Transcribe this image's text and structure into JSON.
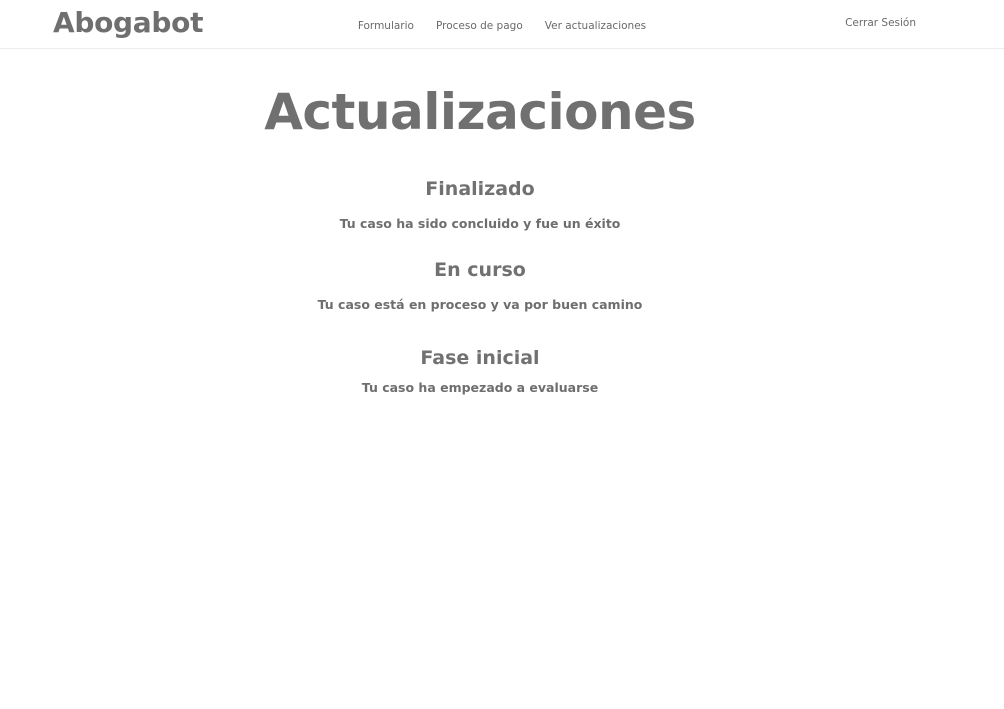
{
  "navbar": {
    "brand": "Abogabot",
    "links": [
      {
        "label": "Formulario"
      },
      {
        "label": "Proceso de pago"
      },
      {
        "label": "Ver actualizaciones"
      }
    ],
    "logout_label": "Cerrar Sesión"
  },
  "main": {
    "title": "Actualizaciones",
    "statuses": [
      {
        "title": "Finalizado",
        "description": "Tu caso ha sido concluido y fue un éxito"
      },
      {
        "title": "En curso",
        "description": "Tu caso está en proceso y va por buen camino"
      },
      {
        "title": "Fase inicial",
        "description": "Tu caso ha empezado a evaluarse"
      }
    ]
  }
}
